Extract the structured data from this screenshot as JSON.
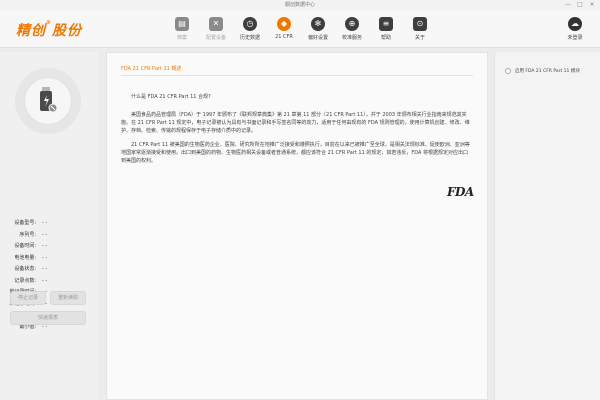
{
  "window": {
    "title": "酮创数据中心",
    "controls": [
      "—",
      "□",
      "✕"
    ]
  },
  "logo": {
    "text": "精创",
    "mark": "®",
    "suffix": "股份"
  },
  "toolbar": {
    "items": [
      {
        "label": "档案",
        "icon": "archive-icon",
        "glyph": "▤",
        "state": "disabled"
      },
      {
        "label": "配置设备",
        "icon": "tools-icon",
        "glyph": "✕",
        "state": "disabled"
      },
      {
        "label": "历史数据",
        "icon": "history-icon",
        "glyph": "◷",
        "state": "normal"
      },
      {
        "label": "21 CFR",
        "icon": "shield-icon",
        "glyph": "◆",
        "state": "active"
      },
      {
        "label": "偏好设置",
        "icon": "gear-icon",
        "glyph": "✻",
        "state": "normal"
      },
      {
        "label": "校准服务",
        "icon": "calibration-icon",
        "glyph": "⊕",
        "state": "normal"
      },
      {
        "label": "帮助",
        "icon": "help-book-icon",
        "glyph": "≡",
        "state": "normal"
      },
      {
        "label": "关于",
        "icon": "about-icon",
        "glyph": "⊙",
        "state": "normal"
      }
    ],
    "user": {
      "label": "未登录",
      "icon": "user-cloud-icon"
    }
  },
  "device_info": {
    "rows": [
      {
        "label": "设备型号:",
        "value": "- -"
      },
      {
        "label": "序列号:",
        "value": "- -"
      },
      {
        "label": "设备时间:",
        "value": "- -"
      },
      {
        "label": "电池电量:",
        "value": "- -"
      },
      {
        "label": "设备状态:",
        "value": "- -"
      },
      {
        "label": "记录点数:",
        "value": "- -"
      },
      {
        "label": "首记录时间:",
        "value": "- -"
      },
      {
        "label": "末记录时间:",
        "value": "- -"
      },
      {
        "label": "最大值:",
        "value": "- -"
      },
      {
        "label": "最小值:",
        "value": "- -"
      }
    ],
    "buttons": {
      "stop": "停止记录",
      "read": "重新读取",
      "quick_report": "快速报表"
    }
  },
  "document": {
    "tab": "FDA 21 CFR Part 11 概述",
    "question": "什么是 FDA 21 CFR Part 11 合规?",
    "para1": "美国食品药品管理局（FDA）于 1997 年颁布了《联邦规章典集》第 21 章第 11 部分（21 CFR Part 11），并于 2003 年颁布相关行业指南来规范其实施。在 21 CFR Part 11 规定中，电子记录被认为具有与书面记录和手写签名同等的效力，适用于任何由现有的 FDA 规则管理的，使用计算机创建、修改、维护、存档、检索、传输的规程保存于电子存储介质中的记录。",
    "para2": "21 CFR Part 11 被美国的生物医药企业、医院、研究所所在地推广泛接受和遵照执行，目前在以来已被推广至全球，是相关法规标准、促使欧洲、亚洲等地国家常逐渐接受和使用。出口到美国的药物、生物医药相关设备或者普通系统，都应该符合 21 CFR Part 11 的规定，如若违反，FDA 将根据规定对应出口到美国的权利。",
    "logo": "FDA"
  },
  "right_panel": {
    "option_label": "启用 FDA 21 CFR Part 11 模块"
  }
}
